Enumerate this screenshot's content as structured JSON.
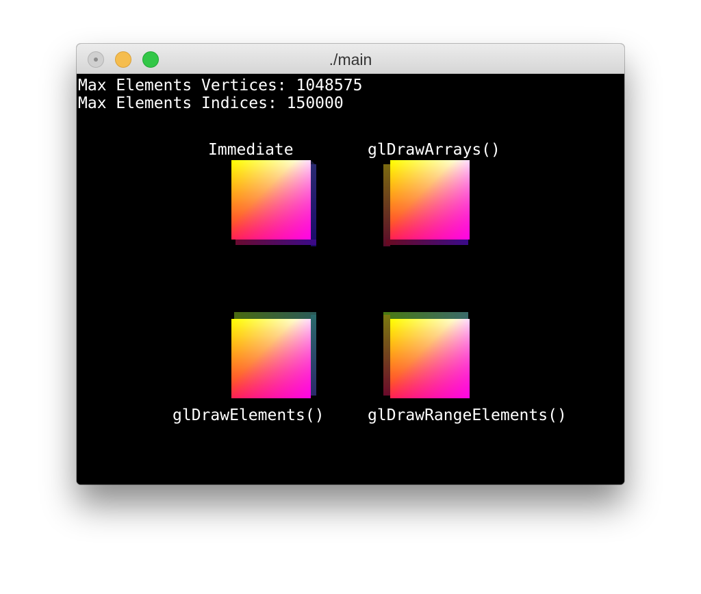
{
  "window": {
    "title": "./main"
  },
  "overlay": {
    "line1": "Max Elements Vertices: 1048575",
    "line2": "Max Elements Indices: 150000"
  },
  "cubes": {
    "top_left_label": "Immediate",
    "top_right_label": "glDrawArrays()",
    "bottom_left_label": "glDrawElements()",
    "bottom_right_label": "glDrawRangeElements()"
  },
  "colors": {
    "background": "#000000",
    "text": "#ffffff",
    "close": "#d0d0d0",
    "minimize": "#f5bd4f",
    "maximize": "#33c748"
  }
}
